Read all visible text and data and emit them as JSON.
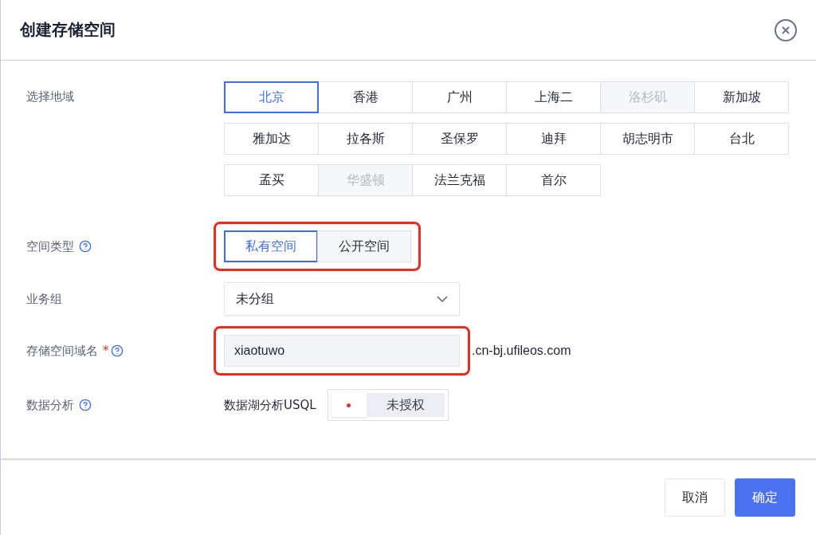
{
  "dialog": {
    "title": "创建存储空间"
  },
  "region": {
    "label": "选择地域",
    "options": [
      {
        "label": "北京",
        "selected": true,
        "disabled": false
      },
      {
        "label": "香港",
        "selected": false,
        "disabled": false
      },
      {
        "label": "广州",
        "selected": false,
        "disabled": false
      },
      {
        "label": "上海二",
        "selected": false,
        "disabled": false
      },
      {
        "label": "洛杉矶",
        "selected": false,
        "disabled": true
      },
      {
        "label": "新加坡",
        "selected": false,
        "disabled": false
      },
      {
        "label": "雅加达",
        "selected": false,
        "disabled": false
      },
      {
        "label": "拉各斯",
        "selected": false,
        "disabled": false
      },
      {
        "label": "圣保罗",
        "selected": false,
        "disabled": false
      },
      {
        "label": "迪拜",
        "selected": false,
        "disabled": false
      },
      {
        "label": "胡志明市",
        "selected": false,
        "disabled": false
      },
      {
        "label": "台北",
        "selected": false,
        "disabled": false
      },
      {
        "label": "孟买",
        "selected": false,
        "disabled": false
      },
      {
        "label": "华盛顿",
        "selected": false,
        "disabled": true
      },
      {
        "label": "法兰克福",
        "selected": false,
        "disabled": false
      },
      {
        "label": "首尔",
        "selected": false,
        "disabled": false
      }
    ]
  },
  "space_type": {
    "label": "空间类型",
    "highlighted": true,
    "options": [
      {
        "label": "私有空间",
        "selected": true
      },
      {
        "label": "公开空间",
        "selected": false
      }
    ]
  },
  "business_group": {
    "label": "业务组",
    "value": "未分组"
  },
  "domain": {
    "label": "存储空间域名",
    "required_mark": "*",
    "highlighted": true,
    "value": "xiaotuwo",
    "suffix": ".cn-bj.ufileos.com"
  },
  "analytics": {
    "label": "数据分析",
    "item": "数据湖分析USQL",
    "on": false,
    "state_text": "未授权"
  },
  "buttons": [
    {
      "label": "取消",
      "kind": "secondary"
    },
    {
      "label": "确定",
      "kind": "primary"
    }
  ]
}
